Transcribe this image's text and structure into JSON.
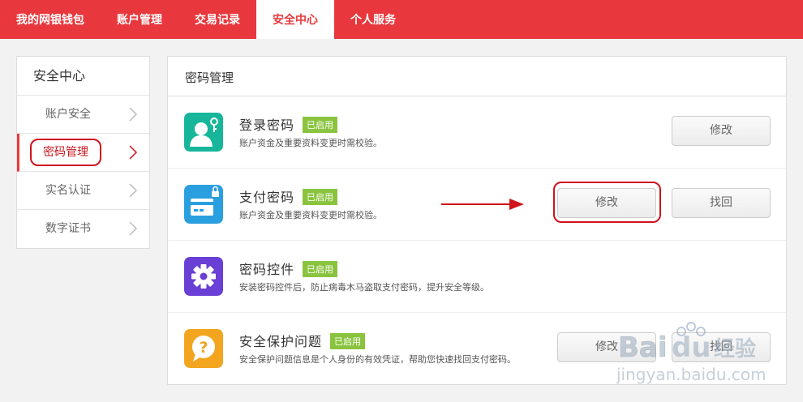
{
  "nav": {
    "tabs": [
      {
        "label": "我的网银钱包",
        "active": false
      },
      {
        "label": "账户管理",
        "active": false
      },
      {
        "label": "交易记录",
        "active": false
      },
      {
        "label": "安全中心",
        "active": true
      },
      {
        "label": "个人服务",
        "active": false
      }
    ]
  },
  "sidebar": {
    "title": "安全中心",
    "items": [
      {
        "label": "账户安全"
      },
      {
        "label": "密码管理"
      },
      {
        "label": "实名认证"
      },
      {
        "label": "数字证书"
      }
    ]
  },
  "main": {
    "title": "密码管理",
    "rows": [
      {
        "name": "登录密码",
        "badge": "已启用",
        "desc": "账户资金及重要资料变更时需校验。",
        "buttons": [
          "修改"
        ]
      },
      {
        "name": "支付密码",
        "badge": "已启用",
        "desc": "账户资金及重要资料变更时需校验。",
        "buttons": [
          "修改",
          "找回"
        ]
      },
      {
        "name": "密码控件",
        "badge": "已启用",
        "desc": "安装密码控件后，防止病毒木马盗取支付密码，提升安全等级。",
        "buttons": []
      },
      {
        "name": "安全保护问题",
        "badge": "已启用",
        "desc": "安全保护问题信息是个人身份的有效凭证，帮助您快速找回支付密码。",
        "buttons": [
          "修改",
          "找回"
        ]
      }
    ]
  },
  "watermark": {
    "brand": "Bai du 经验",
    "url": "jingyan.baidu.com"
  },
  "colors": {
    "brand_red": "#e8383d",
    "badge_green": "#8ac43f",
    "annotation_red": "#d0121b"
  }
}
